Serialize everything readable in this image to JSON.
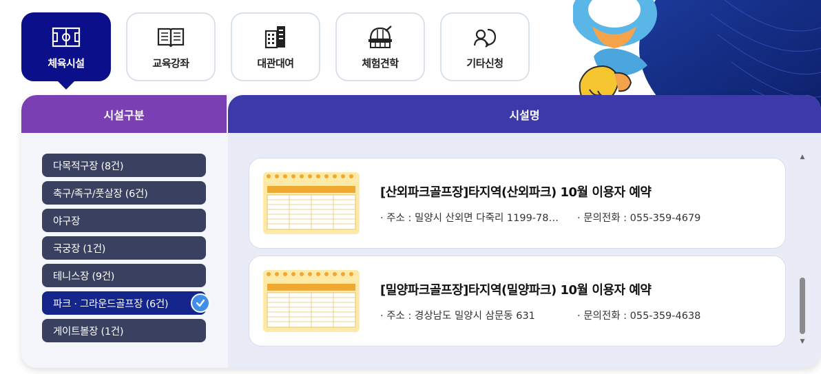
{
  "tabs": [
    {
      "label": "체육시설",
      "icon": "soccer-field-icon",
      "active": true
    },
    {
      "label": "교육강좌",
      "icon": "book-icon",
      "active": false
    },
    {
      "label": "대관대여",
      "icon": "building-icon",
      "active": false
    },
    {
      "label": "체험견학",
      "icon": "observatory-icon",
      "active": false
    },
    {
      "label": "기타신청",
      "icon": "user-cycle-icon",
      "active": false
    }
  ],
  "panel": {
    "left_header": "시설구분",
    "right_header": "시설명"
  },
  "categories": [
    {
      "label": "다목적구장 (8건)",
      "active": false
    },
    {
      "label": "축구/족구/풋살장 (6건)",
      "active": false
    },
    {
      "label": "야구장",
      "active": false
    },
    {
      "label": "국궁장 (1건)",
      "active": false
    },
    {
      "label": "테니스장 (9건)",
      "active": false
    },
    {
      "label": "파크 · 그라운드골프장 (6건)",
      "active": true
    },
    {
      "label": "게이트볼장 (1건)",
      "active": false
    }
  ],
  "facilities": [
    {
      "title": "[산외파크골프장]타지역(산외파크) 10월 이용자 예약",
      "address": "· 주소 : 밀양시 산외면 다죽리 1199-78…",
      "phone": "· 문의전화 : 055-359-4679"
    },
    {
      "title": "[밀양파크골프장]타지역(밀양파크) 10월 이용자 예약",
      "address": "· 주소 : 경상남도 밀양시 삼문동 631",
      "phone": "· 문의전화 : 055-359-4638"
    }
  ],
  "colors": {
    "tab_active": "#0b0f8a",
    "left_header": "#7a3fb3",
    "right_header": "#3c3aa8",
    "category": "#3a4060",
    "category_active": "#14258c",
    "check": "#3f8fe8"
  }
}
